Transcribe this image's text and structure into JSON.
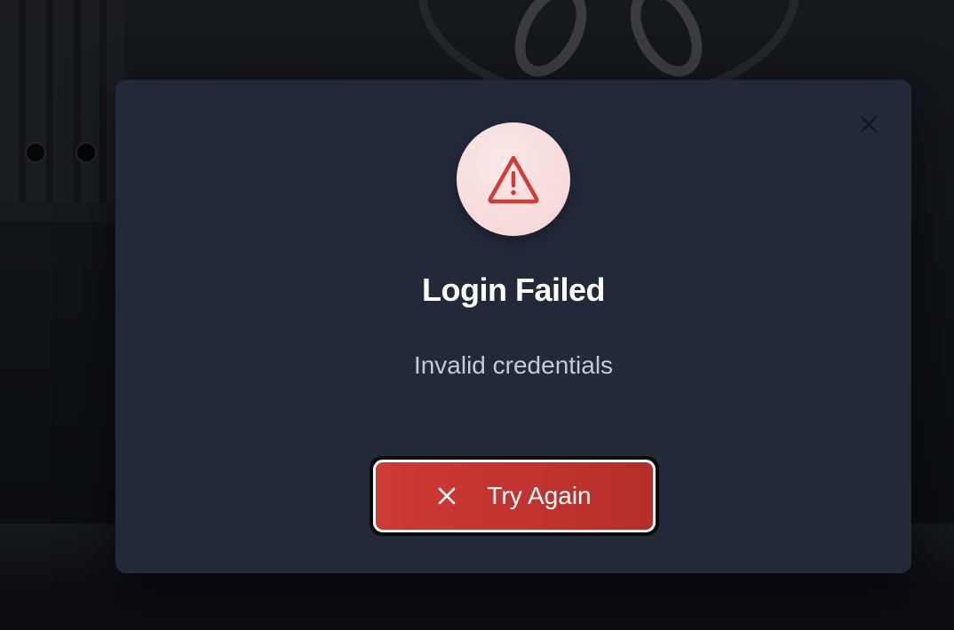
{
  "dialog": {
    "icon": "warning-triangle-icon",
    "title": "Login Failed",
    "message": "Invalid credentials",
    "close_icon": "close-icon",
    "button": {
      "label": "Try Again",
      "icon": "x-icon"
    }
  },
  "colors": {
    "modal_bg": "#222a3a",
    "danger": "#c93531",
    "icon_circle_bg": "#f8dede",
    "title_text": "#ffffff",
    "message_text": "#c4cad6"
  }
}
